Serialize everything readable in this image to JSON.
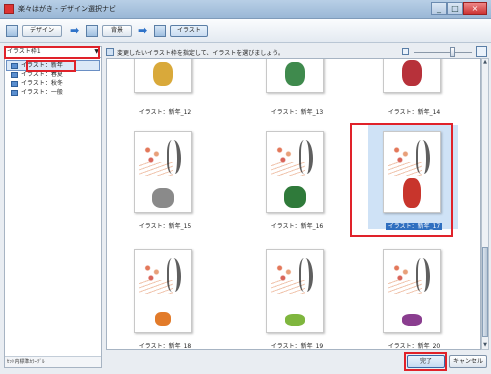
{
  "window": {
    "title": "楽々はがき - デザイン選択ナビ"
  },
  "toolbar": {
    "steps": [
      {
        "label": "デザイン"
      },
      {
        "label": "背景"
      },
      {
        "label": "イラスト"
      }
    ]
  },
  "left_panel": {
    "frame_select": "イラスト枠1",
    "tree": [
      {
        "label": "イラスト：新年"
      },
      {
        "label": "イラスト：春夏"
      },
      {
        "label": "イラスト：秋冬"
      },
      {
        "label": "イラスト：一般"
      }
    ],
    "bottom_label": "ｾｯﾄ内標準ｶﾗｰﾃﾞﾙ"
  },
  "hint": {
    "text": "変更したいイラスト枠を指定して、イラストを選びましょう。"
  },
  "grid": {
    "items": [
      {
        "caption": "イラスト：新年_12",
        "color": "#d9a93a"
      },
      {
        "caption": "イラスト：新年_13",
        "color": "#3f8a4d"
      },
      {
        "caption": "イラスト：新年_14",
        "color": "#b7313a"
      },
      {
        "caption": "イラスト：新年_15",
        "color": "#8a8a8a"
      },
      {
        "caption": "イラスト：新年_16",
        "color": "#2f7a3a"
      },
      {
        "caption": "イラスト：新年_17",
        "color": "#c8352c"
      },
      {
        "caption": "イラスト：新年_18",
        "color": "#e27b2a"
      },
      {
        "caption": "イラスト：新年_19",
        "color": "#7fb63e"
      },
      {
        "caption": "イラスト：新年_20",
        "color": "#8a3d8f"
      }
    ],
    "selected_index": 5
  },
  "buttons": {
    "ok": "完了",
    "cancel": "キャンセル"
  },
  "colors": {
    "highlight": "#e0222a",
    "selection": "#2f6fc0"
  }
}
